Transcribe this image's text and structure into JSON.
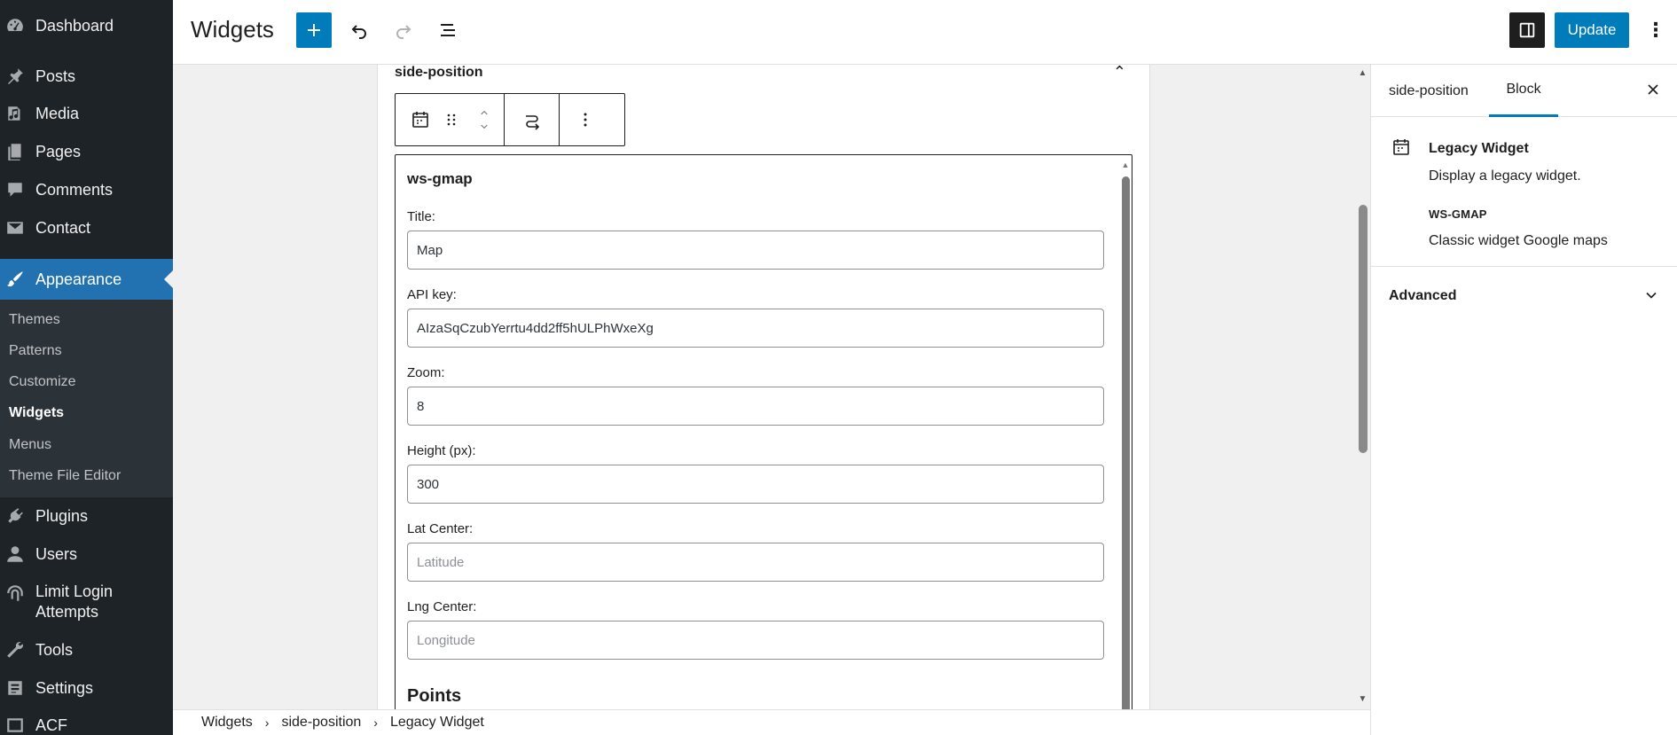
{
  "colors": {
    "sidebar_bg": "#1d2327",
    "accent": "#007cba",
    "active_menu": "#2271b1"
  },
  "admin_menu": {
    "items": [
      {
        "label": "Dashboard",
        "icon": "dashboard-icon"
      },
      {
        "label": "Posts",
        "icon": "pin-icon"
      },
      {
        "label": "Media",
        "icon": "media-icon"
      },
      {
        "label": "Pages",
        "icon": "pages-icon"
      },
      {
        "label": "Comments",
        "icon": "comment-icon"
      },
      {
        "label": "Contact",
        "icon": "mail-icon"
      },
      {
        "label": "Appearance",
        "icon": "paintbrush-icon",
        "active": true
      },
      {
        "label": "Plugins",
        "icon": "plugin-icon"
      },
      {
        "label": "Users",
        "icon": "user-icon"
      },
      {
        "label": "Limit Login\nAttempts",
        "icon": "fingerprint-icon"
      },
      {
        "label": "Tools",
        "icon": "wrench-icon"
      },
      {
        "label": "Settings",
        "icon": "settings-icon"
      },
      {
        "label": "ACF",
        "icon": "acf-icon"
      }
    ],
    "submenu": [
      {
        "label": "Themes"
      },
      {
        "label": "Patterns"
      },
      {
        "label": "Customize"
      },
      {
        "label": "Widgets",
        "current": true
      },
      {
        "label": "Menus"
      },
      {
        "label": "Theme File Editor"
      }
    ]
  },
  "header": {
    "title": "Widgets",
    "update_label": "Update",
    "more_label": "⋮"
  },
  "widget_area": {
    "title": "side-position",
    "widget_name": "ws-gmap",
    "fields": [
      {
        "label": "Title:",
        "value": "Map",
        "placeholder": ""
      },
      {
        "label": "API key:",
        "value": "AIzaSqCzubYerrtu4dd2ff5hULPhWxeXg",
        "placeholder": ""
      },
      {
        "label": "Zoom:",
        "value": "8",
        "placeholder": ""
      },
      {
        "label": "Height (px):",
        "value": "300",
        "placeholder": ""
      },
      {
        "label": "Lat Center:",
        "value": "",
        "placeholder": "Latitude"
      },
      {
        "label": "Lng Center:",
        "value": "",
        "placeholder": "Longitude"
      }
    ],
    "points_heading": "Points"
  },
  "breadcrumb": [
    "Widgets",
    "side-position",
    "Legacy Widget"
  ],
  "settings_panel": {
    "tabs": [
      "side-position",
      "Block"
    ],
    "active_tab": "Block",
    "block_title": "Legacy Widget",
    "block_description": "Display a legacy widget.",
    "widget_type_name": "WS-GMAP",
    "widget_type_description": "Classic widget Google maps",
    "advanced_label": "Advanced"
  }
}
